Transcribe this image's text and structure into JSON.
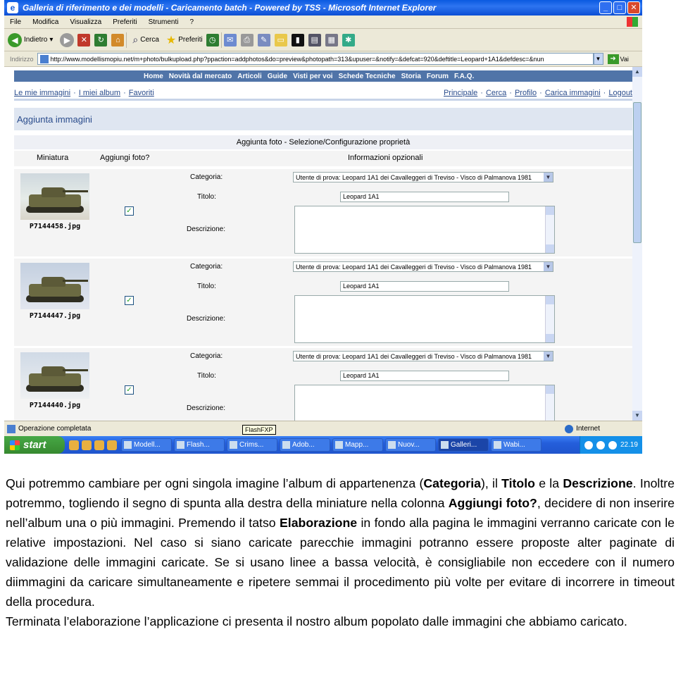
{
  "browser": {
    "title": "Galleria di riferimento e dei modelli - Caricamento batch - Powered by TSS - Microsoft Internet Explorer",
    "menu": [
      "File",
      "Modifica",
      "Visualizza",
      "Preferiti",
      "Strumenti",
      "?"
    ],
    "toolbar": {
      "back": "Indietro",
      "search": "Cerca",
      "favorites": "Preferiti"
    },
    "address_label": "Indirizzo",
    "url": "http://www.modellismopiu.net/m+photo/bulkupload.php?ppaction=addphotos&do=preview&photopath=313&upuser=&notify=&defcat=920&deftitle=Leopard+1A1&defdesc=&nun",
    "go_label": "Vai"
  },
  "site": {
    "nav": [
      "Home",
      "Novità dal mercato",
      "Articoli",
      "Guide",
      "Visti per voi",
      "Schede Tecniche",
      "Storia",
      "Forum",
      "F.A.Q."
    ],
    "subnav_left": [
      "Le mie immagini",
      "I miei album",
      "Favoriti"
    ],
    "subnav_right": [
      "Principale",
      "Cerca",
      "Profilo",
      "Carica immagini",
      "Logout"
    ],
    "page_header": "Aggiunta immagini",
    "table_title": "Aggiunta foto - Selezione/Configurazione proprietà",
    "col_thumb": "Miniatura",
    "col_add": "Aggiungi foto?",
    "col_info": "Informazioni opzionali",
    "label_category": "Categoria:",
    "label_title": "Titolo:",
    "label_desc": "Descrizione:"
  },
  "photos": [
    {
      "file": "P7144458.jpg",
      "category": "Utente di prova: Leopard 1A1 dei Cavalleggeri di Treviso - Visco di Palmanova 1981",
      "title": "Leopard 1A1",
      "checked": "✓"
    },
    {
      "file": "P7144447.jpg",
      "category": "Utente di prova: Leopard 1A1 dei Cavalleggeri di Treviso - Visco di Palmanova 1981",
      "title": "Leopard 1A1",
      "checked": "✓"
    },
    {
      "file": "P7144440.jpg",
      "category": "Utente di prova: Leopard 1A1 dei Cavalleggeri di Treviso - Visco di Palmanova 1981",
      "title": "Leopard 1A1",
      "checked": "✓"
    }
  ],
  "status": {
    "text": "Operazione completata",
    "tooltip": "FlashFXP",
    "zone": "Internet"
  },
  "taskbar": {
    "start": "start",
    "tasks": [
      "Modell...",
      "Flash...",
      "Crims...",
      "Adob...",
      "Mapp...",
      "Nuov...",
      "Galleri...",
      "Wabi..."
    ],
    "clock": "22.19"
  },
  "text": {
    "p1_a": "Qui potremmo cambiare per ogni singola imagine l’album di appartenenza (",
    "p1_b": "Categoria",
    "p1_c": "), il ",
    "p1_d": "Titolo",
    "p1_e": " e la ",
    "p1_f": "Descrizione",
    "p1_g": ". Inoltre potremmo, togliendo il segno di spunta alla destra della miniature nella colonna ",
    "p1_h": "Aggiungi foto?",
    "p1_i": ", decidere di non inserire nell’album una o più immagini. Premendo il tatso ",
    "p1_j": "Elaborazione",
    "p1_k": " in fondo alla pagina le immagini verranno caricate con le relative impostazioni. Nel caso si siano caricate parecchie immagini potranno essere proposte alter paginate di validazione delle immagini caricate. Se si usano linee a bassa velocità, è consigliabile non eccedere con il numero diimmagini da caricare simultaneamente e ripetere semmai il procedimento più volte per evitare di incorrere in timeout della procedura.",
    "p2": "Terminata l’elaborazione l’applicazione ci presenta il nostro album popolato dalle immagini che abbiamo caricato."
  }
}
